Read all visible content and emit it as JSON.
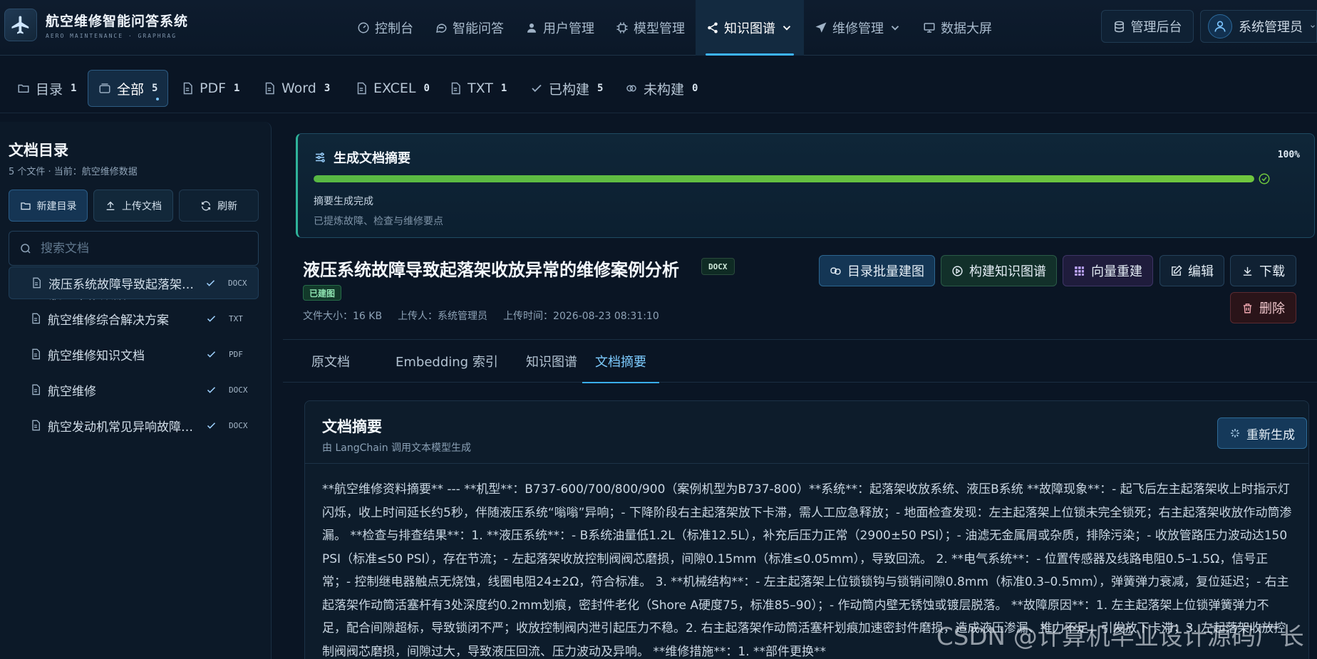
{
  "brand": {
    "title": "航空维修智能问答系统",
    "subtitle": "AERO MAINTENANCE · GRAPHRAG"
  },
  "nav": [
    {
      "label": "控制台",
      "icon": "dashboard-icon"
    },
    {
      "label": "智能问答",
      "icon": "chat-icon"
    },
    {
      "label": "用户管理",
      "icon": "user-icon"
    },
    {
      "label": "模型管理",
      "icon": "chip-icon"
    },
    {
      "label": "知识图谱",
      "icon": "graph-icon",
      "active": true,
      "has_dropdown": true
    },
    {
      "label": "维修管理",
      "icon": "plane-icon",
      "has_dropdown": true
    },
    {
      "label": "数据大屏",
      "icon": "screen-icon"
    }
  ],
  "header": {
    "admin_label": "管理后台",
    "user_name": "系统管理员"
  },
  "filter_tabs": [
    {
      "label": "目录",
      "count": "1",
      "icon": "folder-icon"
    },
    {
      "label": "全部",
      "count": "5",
      "icon": "stack-icon",
      "active": true
    },
    {
      "label": "PDF",
      "count": "1",
      "icon": "file-icon"
    },
    {
      "label": "Word",
      "count": "3",
      "icon": "file-icon"
    },
    {
      "label": "EXCEL",
      "count": "0",
      "icon": "file-icon"
    },
    {
      "label": "TXT",
      "count": "1",
      "icon": "file-icon"
    },
    {
      "label": "已构建",
      "count": "5",
      "icon": "check-icon"
    },
    {
      "label": "未构建",
      "count": "0",
      "icon": "link-icon"
    }
  ],
  "sidebar": {
    "title": "文档目录",
    "subtitle": "5 个文件 · 当前：航空维修数据",
    "new_folder_label": "新建目录",
    "upload_label": "上传文档",
    "refresh_label": "刷新",
    "search_placeholder": "搜索文档",
    "folder": {
      "name": "航空维修数据",
      "count": "5"
    },
    "files": [
      {
        "name": "液压系统故障导致起落架收放异常的维修案例分析",
        "type": "DOCX",
        "selected": true
      },
      {
        "name": "航空维修综合解决方案",
        "type": "TXT"
      },
      {
        "name": "航空维修知识文档",
        "type": "PDF"
      },
      {
        "name": "航空维修",
        "type": "DOCX"
      },
      {
        "name": "航空发动机常见异响故障诊断与处理",
        "type": "DOCX"
      }
    ]
  },
  "progress": {
    "title": "生成文档摘要",
    "percent_label": "100%",
    "percent": 100,
    "status": "摘要生成完成",
    "note": "已提炼故障、检查与维修要点"
  },
  "document": {
    "title": "液压系统故障导致起落架收放异常的维修案例分析",
    "type_badge": "DOCX",
    "built_badge": "已建图",
    "size": "文件大小：16 KB",
    "uploader": "上传人：系统管理员",
    "upload_time": "上传时间：2026-08-23 08:31:10"
  },
  "actions": {
    "batch_build": "目录批量建图",
    "build_graph": "构建知识图谱",
    "vector_rebuild": "向量重建",
    "edit": "编辑",
    "download": "下载",
    "delete": "删除"
  },
  "content_tabs": [
    {
      "label": "原文档"
    },
    {
      "label": "Embedding 索引"
    },
    {
      "label": "知识图谱"
    },
    {
      "label": "文档摘要",
      "active": true
    }
  ],
  "summary": {
    "title": "文档摘要",
    "subtitle": "由 LangChain 调用文本模型生成",
    "regen_label": "重新生成",
    "text": "**航空维修资料摘要** --- **机型**：B737-600/700/800/900（案例机型为B737-800）**系统**：起落架收放系统、液压B系统 **故障现象**：- 起飞后左主起落架收上时指示灯闪烁，收上时间延长约5秒，伴随液压系统“嗡嗡”异响；- 下降阶段右主起落架放下卡滞，需人工应急释放；- 地面检查发现：左主起落架上位锁未完全锁死；右主起落架收放作动筒渗漏。 **检查与排查结果**：1. **液压系统**：- B系统油量低1.2L（标准12.5L），补充后压力正常（2900±50 PSI）；- 油滤无金属屑或杂质，排除污染；- 收放管路压力波动达150 PSI（标准≤50 PSI），存在节流；- 左起落架收放控制阀阀芯磨损，间隙0.15mm（标准≤0.05mm），导致回流。 2. **电气系统**：- 位置传感器及线路电阻0.5–1.5Ω，信号正常；- 控制继电器触点无烧蚀，线圈电阻24±2Ω，符合标准。 3. **机械结构**：- 左主起落架上位锁锁钩与锁销间隙0.8mm（标准0.3–0.5mm），弹簧弹力衰减，复位延迟；- 右主起落架作动筒活塞杆有3处深度约0.2mm划痕，密封件老化（Shore A硬度75，标准85–90）；- 作动筒内壁无锈蚀或镀层脱落。 **故障原因**：1. 左主起落架上位锁弹簧弹力不足，配合间隙超标，导致锁闭不严；收放控制阀内泄引起压力不稳。2. 右主起落架作动筒活塞杆划痕加速密封件磨损，造成液压渗漏、推力不足，引发放下卡滞；3. 左起落架收放控制阀阀芯磨损，间隙过大，导致液压回流、压力波动及异响。 **维修措施**：1. **部件更换**"
  },
  "watermark": "CSDN @计算机毕业设计源码厂长"
}
